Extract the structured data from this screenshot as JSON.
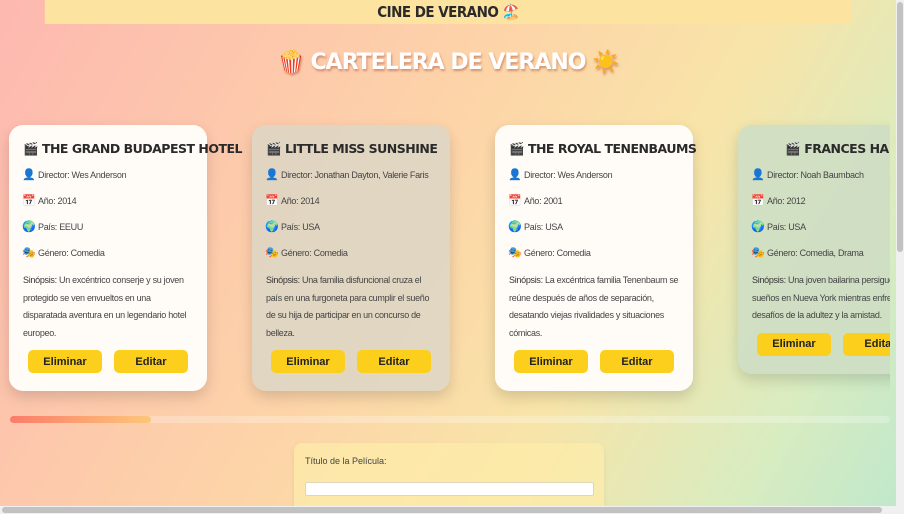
{
  "header": {
    "title": "CINE DE VERANO 🏖️"
  },
  "page": {
    "title": "🍿 CARTELERA DE VERANO ☀️"
  },
  "cards": [
    {
      "title": "THE GRAND BUDAPEST HOTEL",
      "director": "Director: Wes Anderson",
      "year": "Año: 2014",
      "country": "País: EEUU",
      "genre": "Género: Comedia",
      "synopsis_label": "Sinópsis:",
      "synopsis": " Un excéntrico conserje y su joven protegido se ven envueltos en una disparatada aventura en un legendario hotel europeo.",
      "delete_label": "Eliminar",
      "edit_label": "Editar"
    },
    {
      "title": "LITTLE MISS SUNSHINE",
      "director": "Director: Jonathan Dayton, Valerie Faris",
      "year": "Año: 2014",
      "country": "País: USA",
      "genre": "Género: Comedia",
      "synopsis_label": "Sinópsis:",
      "synopsis": " Una familia disfuncional cruza el país en una furgoneta para cumplir el sueño de su hija de participar en un concurso de belleza.",
      "delete_label": "Eliminar",
      "edit_label": "Editar"
    },
    {
      "title": "THE ROYAL TENENBAUMS",
      "director": "Director: Wes Anderson",
      "year": "Año: 2001",
      "country": "País: USA",
      "genre": "Género: Comedia",
      "synopsis_label": "Sinópsis:",
      "synopsis": " La excéntrica familia Tenenbaum se reúne después de años de separación, desatando viejas rivalidades y situaciones cómicas.",
      "delete_label": "Eliminar",
      "edit_label": "Editar"
    },
    {
      "title": "FRANCES HA",
      "director": "Director: Noah Baumbach",
      "year": "Año: 2012",
      "country": "País: USA",
      "genre": "Género: Comedia, Drama",
      "synopsis_label": "Sinópsis:",
      "synopsis": " Una joven bailarina persigue sus sueños en Nueva York mientras enfrenta los desafíos de la adultez y la amistad.",
      "delete_label": "Eliminar",
      "edit_label": "Editar"
    }
  ],
  "carousel": {
    "progress": 0.16
  },
  "form": {
    "title_label": "Título de la Película:",
    "title_value": ""
  },
  "icons": {
    "clapper": "clapperboard-icon",
    "director": "user-icon",
    "year": "calendar-icon",
    "country": "globe-icon",
    "genre": "theater-masks-icon"
  },
  "colors": {
    "button": "#fbcf1c",
    "progress_start": "#fb7c6a",
    "progress_end": "#fcc77a"
  }
}
